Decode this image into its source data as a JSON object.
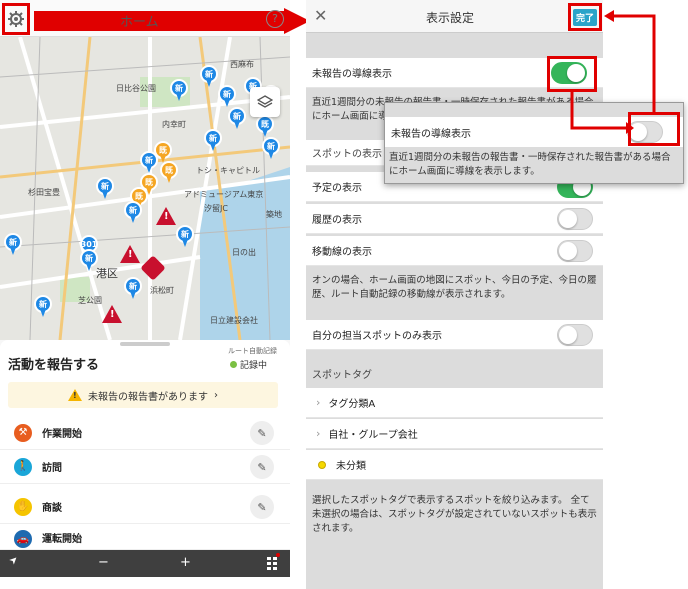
{
  "home": {
    "title": "ホーム",
    "help": "?",
    "map_labels": [
      "西麻布",
      "日比谷公園",
      "内幸町",
      "トシ・キャピトル",
      "杉田宝豊",
      "アドミュージアム東京",
      "汐留JC",
      "築地",
      "港区",
      "芝公園",
      "浜松町",
      "日の出",
      "港区",
      "日立建設会社"
    ]
  },
  "report": {
    "title": "活動を報告する",
    "route_label": "ルート自動記録",
    "recording_status": "記録中",
    "banner": "未報告の報告書があります",
    "banner_chevron": "›",
    "activities": [
      {
        "label": "作業開始",
        "color": "#e85d1f",
        "icon": "wrench-icon"
      },
      {
        "label": "訪問",
        "color": "#1aa6d8",
        "icon": "walker-icon"
      },
      {
        "label": "商談",
        "color": "#f5c400",
        "icon": "handshake-icon"
      },
      {
        "label": "運転開始",
        "color": "#1e6ab0",
        "icon": "car-icon"
      }
    ]
  },
  "bottom_bar": {
    "locate": "➤",
    "zoom_out": "−",
    "zoom_in": "+"
  },
  "settings": {
    "title": "表示設定",
    "close": "✕",
    "done": "完了",
    "unreported_toggle": {
      "label": "未報告の導線表示",
      "on": true
    },
    "unreported_note": "直近1週間分の未報告の報告書・一時保存された報告書がある場合にホーム画面に導線を表示します。",
    "spot_section": "スポットの表示",
    "toggles": [
      {
        "label": "予定の表示",
        "on": true
      },
      {
        "label": "履歴の表示",
        "on": false
      },
      {
        "label": "移動線の表示",
        "on": false
      }
    ],
    "display_note": "オンの場合、ホーム画面の地図にスポット、今日の予定、今日の履歴、ルート自動記録の移動線が表示されます。",
    "my_spots": {
      "label": "自分の担当スポットのみ表示",
      "on": false
    },
    "tag_section": "スポットタグ",
    "tags": [
      "タグ分類A",
      "自社・グループ会社"
    ],
    "untagged": "未分類",
    "tag_note": "選択したスポットタグで表示するスポットを絞り込みます。 全て未選択の場合は、スポットタグが設定されていないスポットも表示されます。"
  },
  "popup": {
    "label": "未報告の導線表示",
    "description": "直近1週間分の未報告の報告書・一時保存された報告書がある場合にホーム画面に導線を表示します。"
  }
}
